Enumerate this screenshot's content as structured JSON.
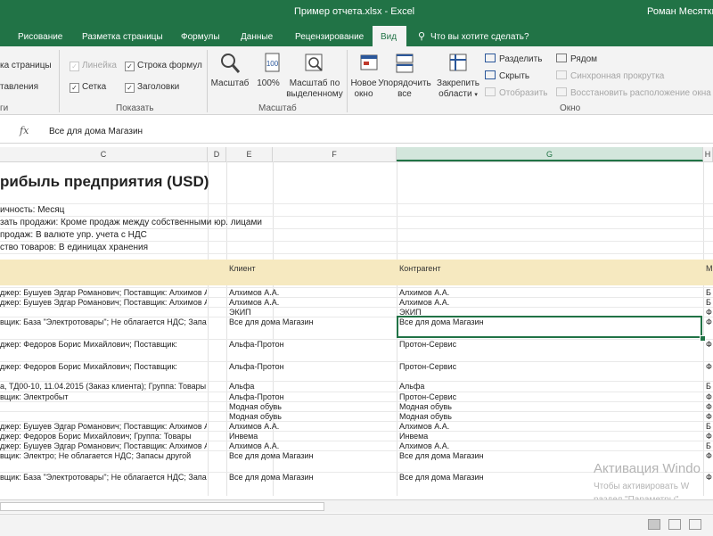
{
  "window": {
    "title": "Пример отчета.xlsx  -  Excel",
    "user": "Роман Месяткин"
  },
  "tabs": [
    "Рисование",
    "Разметка страницы",
    "Формулы",
    "Данные",
    "Рецензирование",
    "Вид"
  ],
  "active_tab": "Вид",
  "tellme": {
    "placeholder": "Что вы хотите сделать?"
  },
  "ribbon": {
    "left_items": [
      "ка страницы",
      "тавления"
    ],
    "left_group_label": "ги",
    "show": {
      "ruler": "Линейка",
      "formula_bar": "Строка формул",
      "gridlines": "Сетка",
      "headings": "Заголовки",
      "label": "Показать"
    },
    "zoom": {
      "zoom": "Масштаб",
      "hundred": "100%",
      "selection_line1": "Масштаб по",
      "selection_line2": "выделенному",
      "label": "Масштаб"
    },
    "window": {
      "new_line1": "Новое",
      "new_line2": "окно",
      "arrange_line1": "Упорядочить",
      "arrange_line2": "все",
      "freeze_line1": "Закрепить",
      "freeze_line2": "области",
      "split": "Разделить",
      "hide": "Скрыть",
      "unhide": "Отобразить",
      "side_by_side": "Рядом",
      "sync_scroll": "Синхронная прокрутка",
      "reset_position": "Восстановить расположение окна",
      "label": "Окно"
    }
  },
  "formula": {
    "fx": "fx",
    "value": "Все для дома Магазин"
  },
  "columns": [
    "C",
    "D",
    "E",
    "F",
    "G",
    "H"
  ],
  "sheet": {
    "title": "рибыль предприятия (USD)",
    "params": [
      "ичность: Месяц",
      "зать продажи: Кроме продаж между собственными юр. лицами",
      "продаж: В валюте упр. учета с НДС",
      "ство товаров: В единицах хранения"
    ],
    "headers": {
      "client": "Клиент",
      "contractor": "Контрагент",
      "m": "М"
    },
    "rows": [
      {
        "c": "джер: Бушуев Эдгар Романович; Поставщик: Алхимов А.А.",
        "client": "Алхимов А.А.",
        "contractor": "Алхимов А.А.",
        "h": "Б"
      },
      {
        "c": "джер: Бушуев Эдгар Романович; Поставщик: Алхимов А.А.",
        "client": "Алхимов А.А.",
        "contractor": "Алхимов А.А.",
        "h": "Б"
      },
      {
        "c": "",
        "client": "ЭКИП",
        "contractor": "ЭКИП",
        "h": "Ф"
      },
      {
        "c": "вщик: База \"Электротовары\"; Не облагается НДС; Запасы",
        "client": "Все для дома Магазин",
        "contractor": "Все для дома Магазин",
        "h": "Ф"
      },
      {
        "c": "джер: Федоров Борис Михайлович; Поставщик:",
        "client": "Альфа-Протон",
        "contractor": "Протон-Сервис",
        "h": "Ф"
      },
      {
        "c": "джер: Федоров Борис Михайлович; Поставщик:",
        "client": "Альфа-Протон",
        "contractor": "Протон-Сервис",
        "h": "Ф"
      },
      {
        "c": "а, ТД00-10, 11.04.2015 (Заказ клиента); Группа: Товары",
        "client": "Альфа",
        "contractor": "Альфа",
        "h": "Б"
      },
      {
        "c": "вщик: Электробыт",
        "client": "Альфа-Протон",
        "contractor": "Протон-Сервис",
        "h": "Ф"
      },
      {
        "c": "",
        "client": "Модная обувь",
        "contractor": "Модная обувь",
        "h": "Ф"
      },
      {
        "c": "",
        "client": "Модная обувь",
        "contractor": "Модная обувь",
        "h": "Ф"
      },
      {
        "c": "джер: Бушуев Эдгар Романович; Поставщик: Алхимов А.А.",
        "client": "Алхимов А.А.",
        "contractor": "Алхимов А.А.",
        "h": "Б"
      },
      {
        "c": "джер: Федоров Борис Михайлович; Группа: Товары",
        "client": "Инвема",
        "contractor": "Инвема",
        "h": "Ф"
      },
      {
        "c": "джер: Бушуев Эдгар Романович; Поставщик: Алхимов А.А.",
        "client": "Алхимов А.А.",
        "contractor": "Алхимов А.А.",
        "h": "Б"
      },
      {
        "c": "вщик: Электро; Не облагается НДС; Запасы другой",
        "client": "Все для дома Магазин",
        "contractor": "Все для дома Магазин",
        "h": "Ф"
      },
      {
        "c": "вщик: База \"Электротовары\"; Не облагается НДС; Запасы",
        "client": "Все для дома Магазин",
        "contractor": "Все для дома Магазин",
        "h": "Ф"
      }
    ]
  },
  "activation": {
    "line1": "Активация Windo",
    "line2": "Чтобы активировать W",
    "line3": "раздел \"Параметры\""
  },
  "colors": {
    "accent": "#217346",
    "header_band": "#f6e9c0"
  }
}
